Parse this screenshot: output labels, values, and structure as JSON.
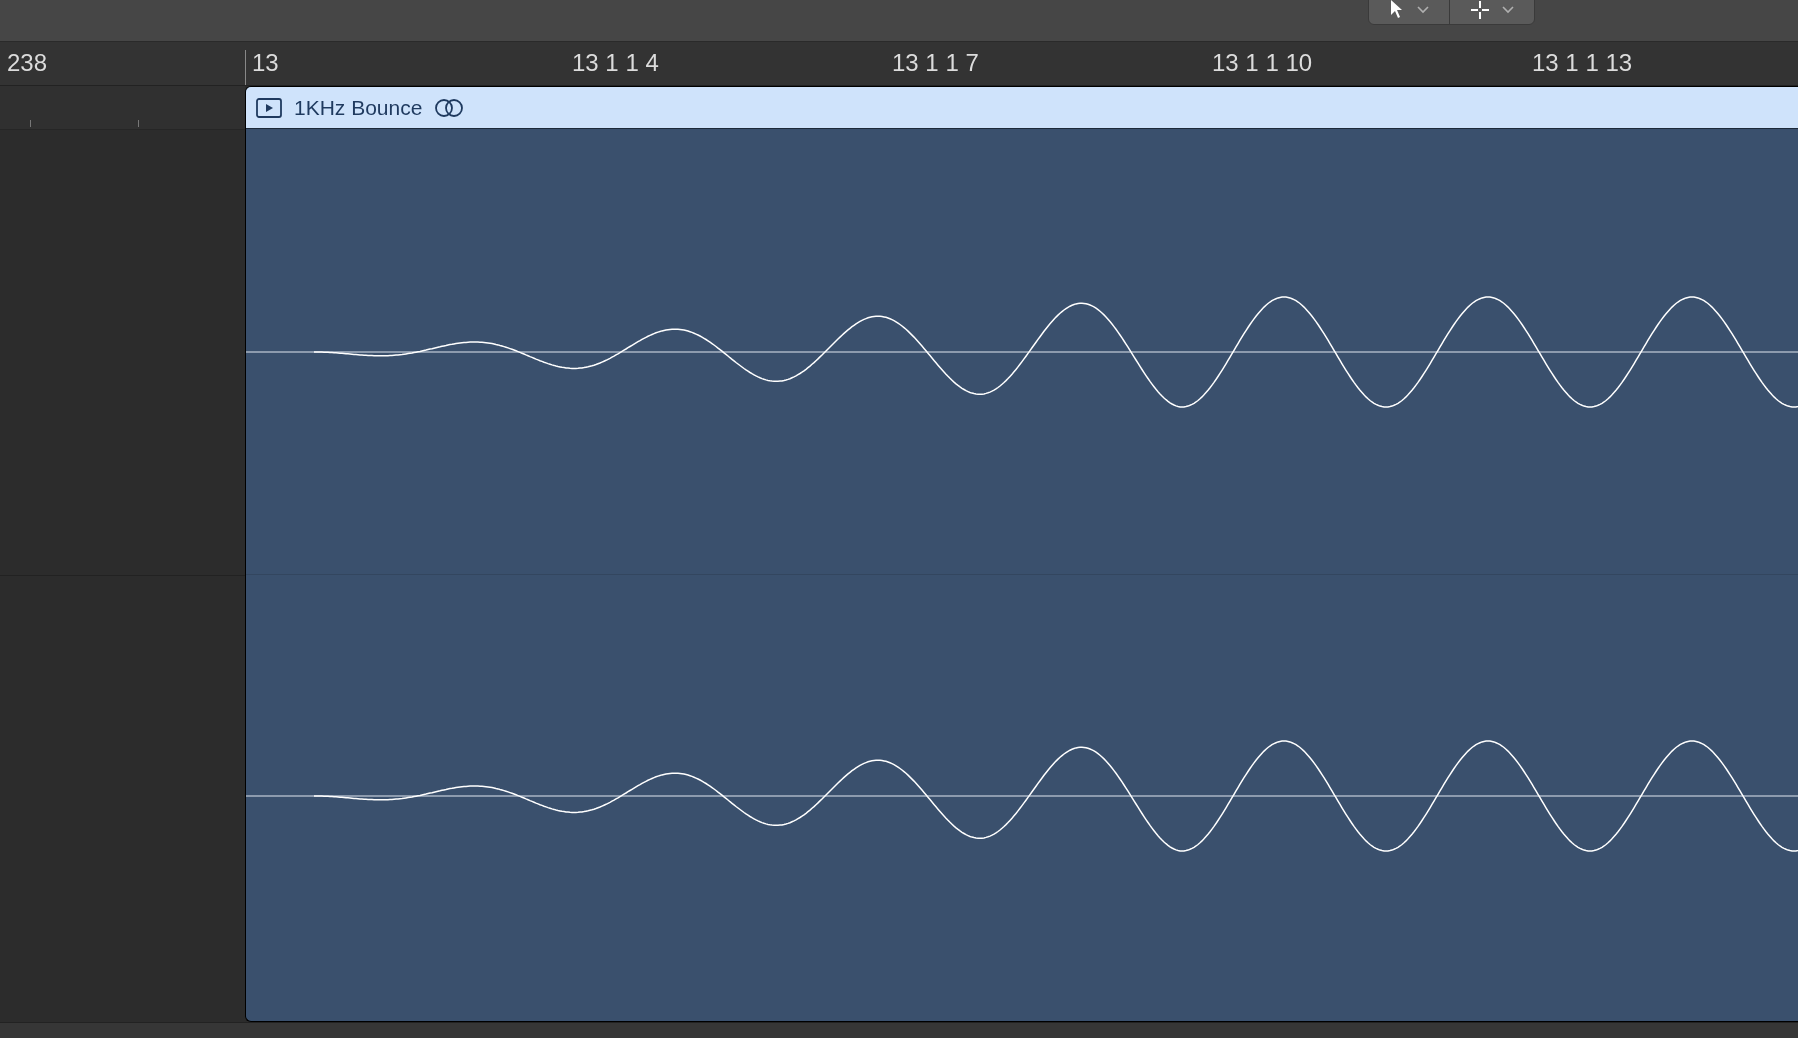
{
  "ruler": {
    "labels": [
      "238",
      "13",
      "13 1 1 4",
      "13 1 1 7",
      "13 1 1 10",
      "13 1 1 13"
    ]
  },
  "region": {
    "title": "1KHz Bounce",
    "channels": [
      {
        "kind": "waveform"
      },
      {
        "kind": "waveform"
      }
    ]
  }
}
